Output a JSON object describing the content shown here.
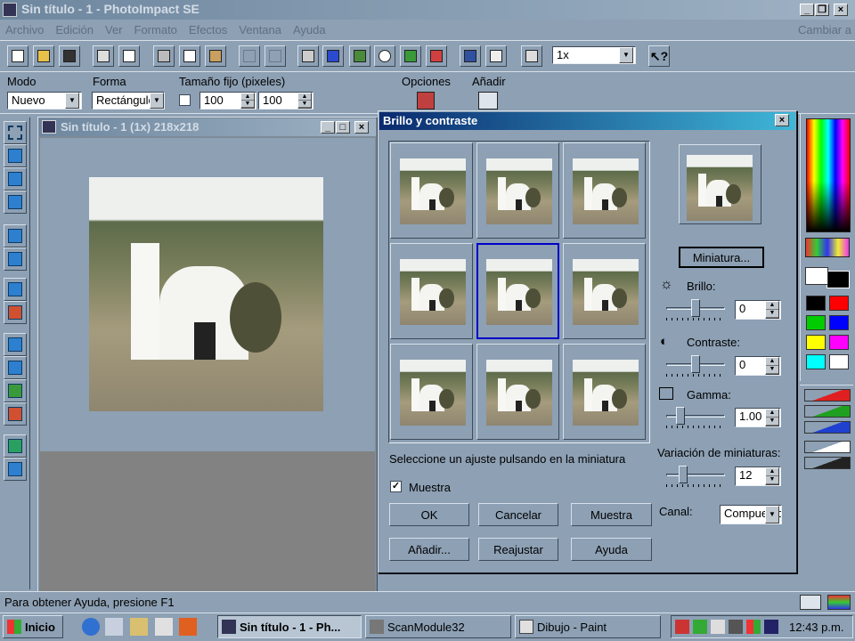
{
  "app": {
    "title": "Sin título - 1 - PhotoImpact SE",
    "cambiar": "Cambiar a"
  },
  "menu": [
    "Archivo",
    "Edición",
    "Ver",
    "Formato",
    "Efectos",
    "Ventana",
    "Ayuda"
  ],
  "toolbar": {
    "zoom_value": "1x",
    "help_icon": "help-arrow-icon"
  },
  "attrbar": {
    "modo_label": "Modo",
    "modo_value": "Nuevo",
    "forma_label": "Forma",
    "forma_value": "Rectángulo",
    "tamano_label": "Tamaño fijo (pixeles)",
    "width": "100",
    "height": "100",
    "opciones_label": "Opciones",
    "anadir_label": "Añadir"
  },
  "doc": {
    "title": "Sin título - 1 (1x) 218x218"
  },
  "dialog": {
    "title": "Brillo y contraste",
    "hint": "Seleccione un ajuste pulsando en la miniatura",
    "muestra_check": "Muestra",
    "miniatura_button": "Miniatura...",
    "brillo_label": "Brillo:",
    "brillo_value": "0",
    "brillo_level": 0.5,
    "contraste_label": "Contraste:",
    "contraste_value": "0",
    "contraste_level": 0.5,
    "gamma_label": "Gamma:",
    "gamma_value": "1.00",
    "gamma_level": 0.2,
    "variacion_label": "Variación de miniaturas:",
    "variacion_value": "12",
    "variacion_level": 0.25,
    "canal_label": "Canal:",
    "canal_value": "Compuesto",
    "buttons": {
      "ok": "OK",
      "cancelar": "Cancelar",
      "muestra": "Muestra",
      "anadir": "Añadir...",
      "reajustar": "Reajustar",
      "ayuda": "Ayuda"
    },
    "selected_thumb": 4
  },
  "status": {
    "text": "Para obtener Ayuda, presione F1"
  },
  "taskbar": {
    "start": "Inicio",
    "tasks": [
      "Sin título - 1 - Ph...",
      "ScanModule32",
      "Dibujo - Paint"
    ],
    "clock": "12:43 p.m."
  },
  "colors": {
    "desktop": "#8da0b4",
    "dialog_title_from": "#0a2a6e",
    "dialog_title_to": "#3fb7d8",
    "selection": "#0000c8"
  },
  "swatches": [
    "#000000",
    "#ff0000",
    "#00cc00",
    "#0000ff",
    "#ffff00",
    "#ff00ff",
    "#00ffff",
    "#ffffff"
  ]
}
